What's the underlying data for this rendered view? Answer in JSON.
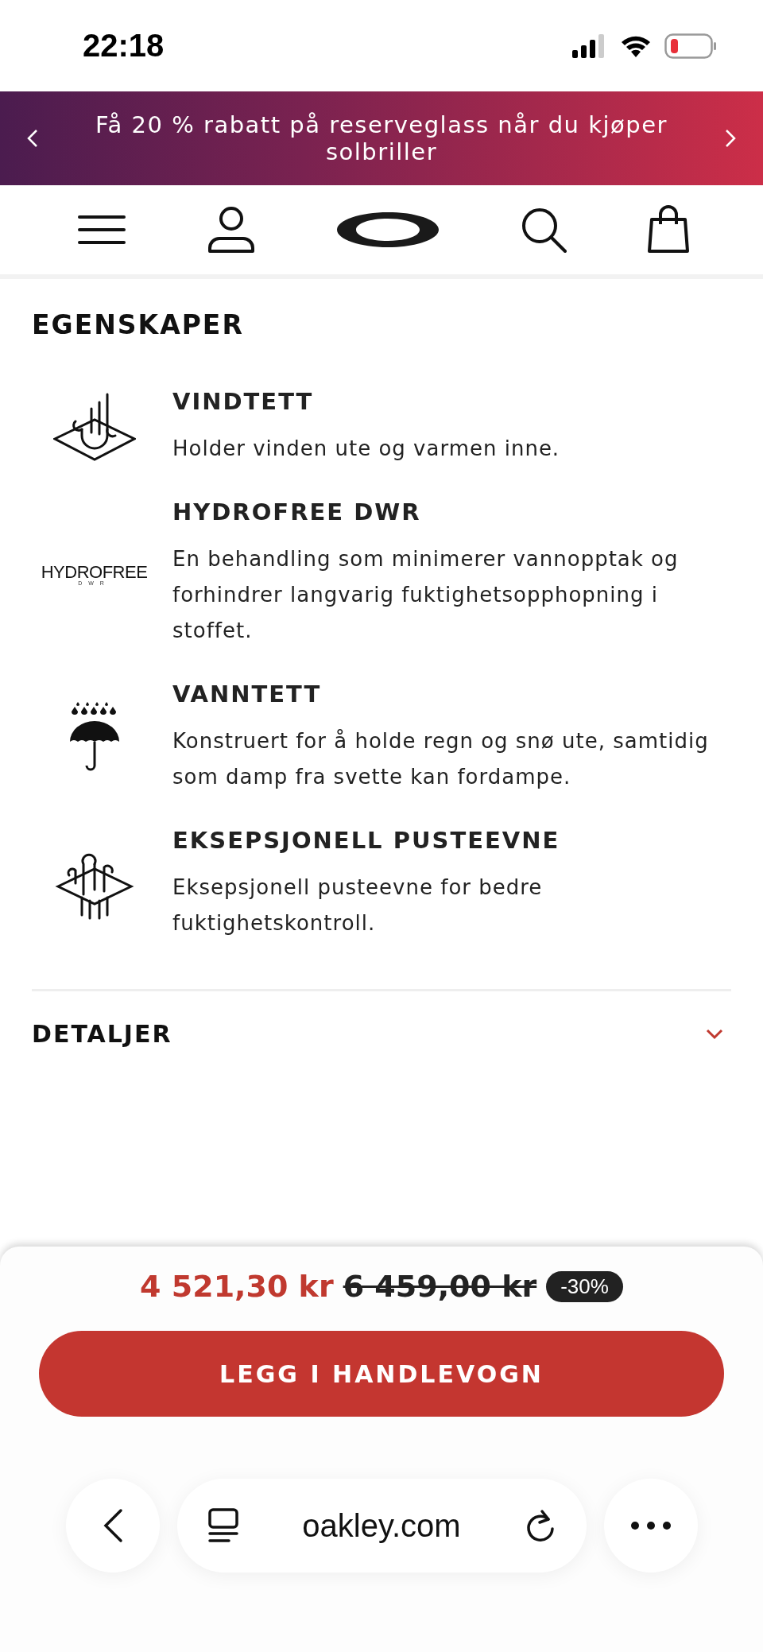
{
  "status_bar": {
    "time": "22:18"
  },
  "promo_banner": {
    "text": "Få 20 % rabatt på reserveglass når du kjøper solbriller"
  },
  "features": {
    "heading": "EGENSKAPER",
    "items": [
      {
        "kind": "wind",
        "title": "VINDTETT",
        "description": "Holder vinden ute og varmen inne."
      },
      {
        "kind": "logo",
        "logo_text": "HYDROFREE",
        "logo_subtext": "DWR",
        "title": "HYDROFREE DWR",
        "description": "En behandling som minimerer vannopptak og forhindrer langvarig fuktighetsopphopning i stoffet."
      },
      {
        "kind": "umbrella",
        "title": "VANNTETT",
        "description": "Konstruert for å holde regn og snø ute, samtidig som damp fra svette kan fordampe."
      },
      {
        "kind": "breathable",
        "title": "EKSEPSJONELL PUSTEEVNE",
        "description": "Eksepsjonell pusteevne for bedre fuktighetskontroll."
      }
    ]
  },
  "details": {
    "title": "DETALJER",
    "expanded": false
  },
  "purchase": {
    "price": "4 521,30 kr",
    "old_price": "6 459,00 kr",
    "discount": "-30%",
    "button": "LEGG I HANDLEVOGN"
  },
  "browser": {
    "url": "oakley.com"
  }
}
